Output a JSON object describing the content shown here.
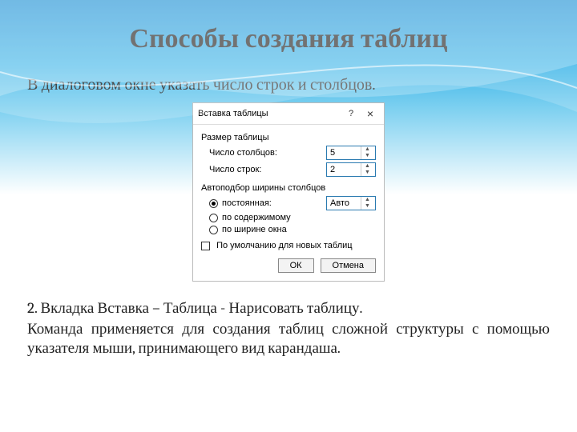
{
  "title": "Способы создания таблиц",
  "intro": "В диалоговом окне указать число строк и столбцов.",
  "dialog": {
    "title": "Вставка таблицы",
    "help": "?",
    "close": "×",
    "section_size": "Размер таблицы",
    "cols_label": "Число столбцов:",
    "cols_value": "5",
    "rows_label": "Число строк:",
    "rows_value": "2",
    "section_autofit": "Автоподбор ширины столбцов",
    "opt_fixed": "постоянная:",
    "opt_fixed_value": "Авто",
    "opt_content": "по содержимому",
    "opt_window": "по ширине окна",
    "remember": "По умолчанию для новых таблиц",
    "ok": "ОК",
    "cancel": "Отмена"
  },
  "para_2": "2. Вкладка Вставка – Таблица - Нарисовать таблицу.",
  "para_3": "Команда применяется для создания таблиц сложной структуры с помощью указателя мыши, принимающего вид карандаша."
}
